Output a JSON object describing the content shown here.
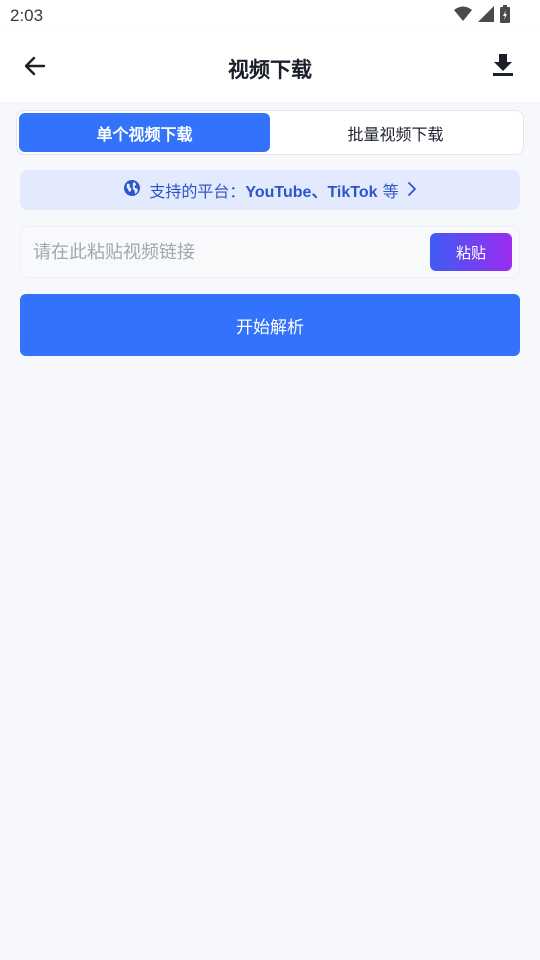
{
  "status_bar": {
    "time": "2:03",
    "icons": [
      "wifi-icon",
      "signal-icon",
      "battery-icon"
    ]
  },
  "header": {
    "title": "视频下载",
    "back_icon": "arrow-left-icon",
    "download_icon": "download-icon"
  },
  "tabs": [
    {
      "label": "单个视频下载",
      "active": true
    },
    {
      "label": "批量视频下载",
      "active": false
    }
  ],
  "platform_banner": {
    "label": "支持的平台：",
    "platforms": "YouTube、TikTok",
    "suffix": "等",
    "icon": "globe-icon",
    "chevron_icon": "chevron-right-icon"
  },
  "url_input": {
    "value": "",
    "placeholder": "请在此粘贴视频链接"
  },
  "paste_button": {
    "label": "粘贴"
  },
  "start_button": {
    "label": "开始解析"
  },
  "colors": {
    "accent": "#3372fa",
    "banner_bg": "#e3eafd",
    "banner_text": "#2c55c9",
    "paste_gradient_start": "#3f5cf5",
    "paste_gradient_end": "#9b2cf0",
    "background": "#f7f8fb"
  }
}
